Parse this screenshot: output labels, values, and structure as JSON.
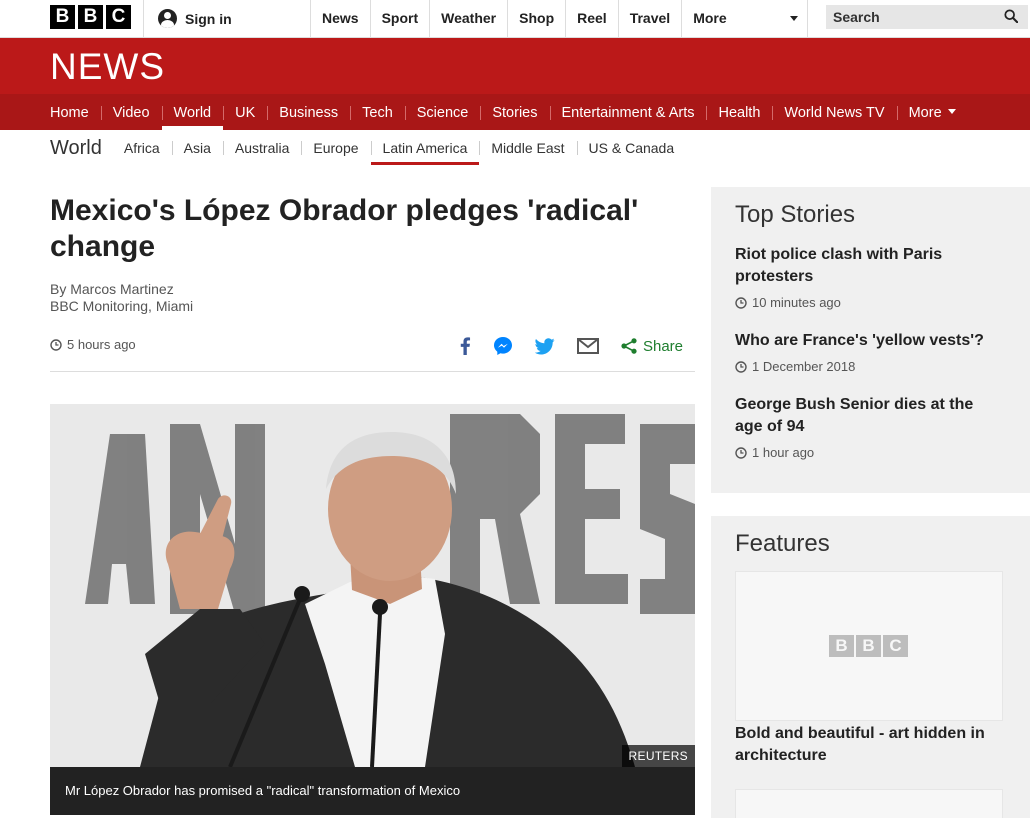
{
  "topbar": {
    "logo_letters": [
      "B",
      "B",
      "C"
    ],
    "signin_label": "Sign in",
    "nav_items": [
      "News",
      "Sport",
      "Weather",
      "Shop",
      "Reel",
      "Travel"
    ],
    "more_label": "More",
    "search_placeholder": "Search"
  },
  "banner": {
    "wordmark": "NEWS",
    "color": "#bb1919"
  },
  "main_nav": {
    "items": [
      "Home",
      "Video",
      "World",
      "UK",
      "Business",
      "Tech",
      "Science",
      "Stories",
      "Entertainment & Arts",
      "Health",
      "World News TV"
    ],
    "more_label": "More",
    "active": "World"
  },
  "section_nav": {
    "title": "World",
    "items": [
      "Africa",
      "Asia",
      "Australia",
      "Europe",
      "Latin America",
      "Middle East",
      "US & Canada"
    ],
    "active": "Latin America"
  },
  "article": {
    "headline": "Mexico's López Obrador pledges 'radical' change",
    "author": "By Marcos Martinez",
    "author_role": "BBC Monitoring, Miami",
    "timestamp": "5 hours ago",
    "share_label": "Share",
    "share_icons": [
      "facebook-icon",
      "messenger-icon",
      "twitter-icon",
      "email-icon",
      "share-icon"
    ],
    "image_credit": "REUTERS",
    "image_caption": "Mr López Obrador has promised a \"radical\" transformation of Mexico"
  },
  "sidebar": {
    "top_stories": {
      "title": "Top Stories",
      "stories": [
        {
          "title": "Riot police clash with Paris protesters",
          "time": "10 minutes ago"
        },
        {
          "title": "Who are France's 'yellow vests'?",
          "time": "1 December 2018"
        },
        {
          "title": "George Bush Senior dies at the age of 94",
          "time": "1 hour ago"
        }
      ]
    },
    "features": {
      "title": "Features",
      "placeholder_logo": [
        "B",
        "B",
        "C"
      ],
      "items": [
        {
          "title": "Bold and beautiful - art hidden in architecture"
        }
      ]
    }
  }
}
